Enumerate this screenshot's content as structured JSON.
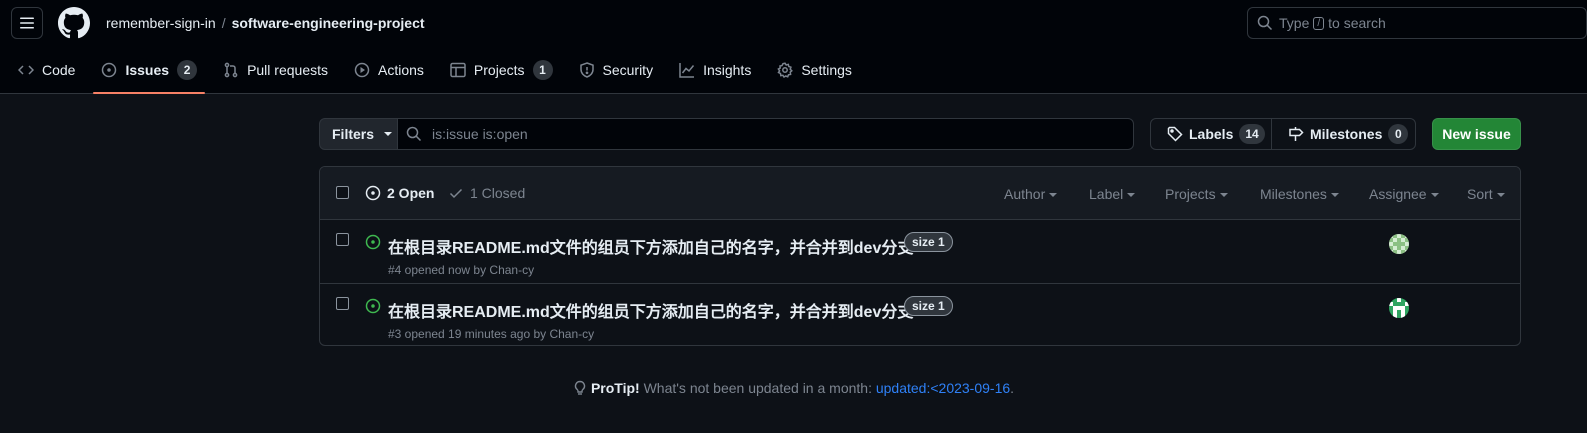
{
  "header": {
    "owner": "remember-sign-in",
    "separator": "/",
    "repo": "software-engineering-project",
    "search_prefix": "Type",
    "search_key": "/",
    "search_suffix": "to search"
  },
  "tabs": [
    {
      "label": "Code",
      "icon": "code-icon"
    },
    {
      "label": "Issues",
      "icon": "issue-opened-icon",
      "count": "2",
      "active": true
    },
    {
      "label": "Pull requests",
      "icon": "git-pull-request-icon"
    },
    {
      "label": "Actions",
      "icon": "play-icon"
    },
    {
      "label": "Projects",
      "icon": "table-icon",
      "count": "1"
    },
    {
      "label": "Security",
      "icon": "shield-icon"
    },
    {
      "label": "Insights",
      "icon": "graph-icon"
    },
    {
      "label": "Settings",
      "icon": "gear-icon"
    }
  ],
  "toolbar": {
    "filters_label": "Filters",
    "filter_value": "is:issue is:open",
    "labels_label": "Labels",
    "labels_count": "14",
    "milestones_label": "Milestones",
    "milestones_count": "0",
    "new_issue_label": "New issue"
  },
  "issues_header": {
    "open_label": "2 Open",
    "closed_label": "1 Closed",
    "filters": [
      "Author",
      "Label",
      "Projects",
      "Milestones",
      "Assignee",
      "Sort"
    ]
  },
  "issues": [
    {
      "title": "在根目录README.md文件的组员下方添加自己的名字，并合并到dev分支",
      "label": "size 1",
      "meta": "#4 opened now by Chan-cy"
    },
    {
      "title": "在根目录README.md文件的组员下方添加自己的名字，并合并到dev分支",
      "label": "size 1",
      "meta": "#3 opened 19 minutes ago by Chan-cy"
    }
  ],
  "protip": {
    "label": "ProTip!",
    "text": "What's not been updated in a month:",
    "link": "updated:<2023-09-16",
    "end": "."
  },
  "colors": {
    "background": "#0d1117",
    "accent_underline": "#f78166",
    "open_icon": "#3fb950",
    "primary_button": "#238636",
    "link": "#2f81f7"
  }
}
